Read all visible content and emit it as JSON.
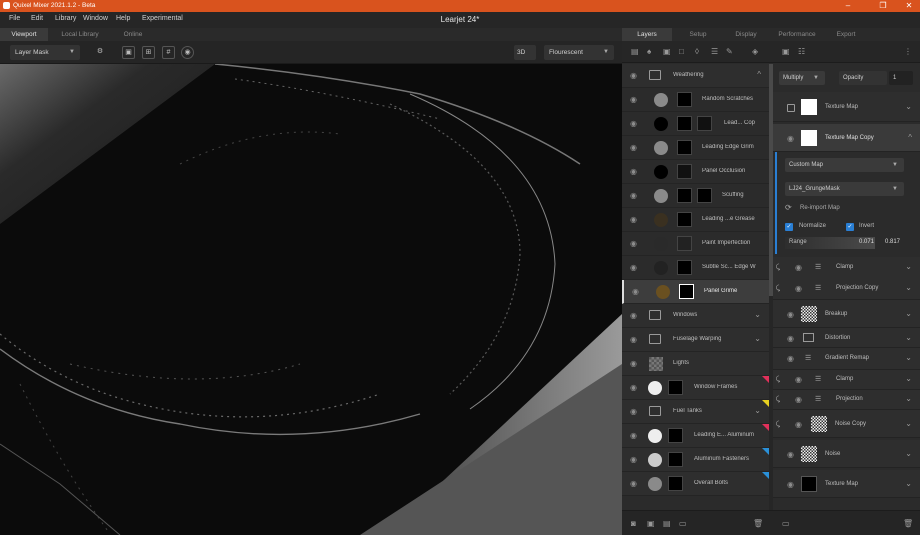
{
  "app": {
    "title": "Quixel Mixer 2021.1.2 - Beta",
    "document": "Learjet 24*"
  },
  "window_controls": {
    "minimize": "–",
    "maximize": "❐",
    "close": "✕"
  },
  "menu": [
    "File",
    "Edit",
    "Library",
    "Window",
    "Help",
    "Experimental"
  ],
  "viewport_tabs": [
    "Viewport",
    "Local Library",
    "Online"
  ],
  "panel_tabs": [
    "Layers",
    "Setup",
    "Display",
    "Performance",
    "Export"
  ],
  "toolbar": {
    "mode": "Layer Mask",
    "view_mode": "3D",
    "lighting": "Flourescent"
  },
  "layers": [
    {
      "name": "Weathering",
      "kind": "folder",
      "expanded": true
    },
    {
      "name": "Random Scratches",
      "kind": "layer",
      "swatch": "#8a8a8a"
    },
    {
      "name": "Lead... Cop",
      "kind": "layer",
      "swatch": "#000000"
    },
    {
      "name": "Leading Edge Grim",
      "kind": "layer",
      "swatch": "#8a8a8a"
    },
    {
      "name": "Panel Occlusion",
      "kind": "layer",
      "swatch": "#000000"
    },
    {
      "name": "Scuffing",
      "kind": "layer",
      "swatch": "#8a8a8a"
    },
    {
      "name": "Leading ...e Grease",
      "kind": "layer",
      "swatch": "#3a3020"
    },
    {
      "name": "Paint Imperfection",
      "kind": "layer",
      "swatch": "#2a2a2a"
    },
    {
      "name": "Subtle Sc... Edge W",
      "kind": "layer",
      "swatch": "#222222"
    },
    {
      "name": "Panel Grime",
      "kind": "layer",
      "swatch": "#6a5020",
      "selected": true
    },
    {
      "name": "Windows",
      "kind": "folder"
    },
    {
      "name": "Fuselage Warping",
      "kind": "folder"
    },
    {
      "name": "Lights",
      "kind": "layer",
      "swatch": "checker"
    },
    {
      "name": "Window Frames",
      "kind": "layer",
      "swatch": "#eeeeee",
      "flag": "#e0305a"
    },
    {
      "name": "Fuel Tanks",
      "kind": "folder",
      "flag": "#e6d020"
    },
    {
      "name": "Leading E... Aluminum",
      "kind": "layer",
      "swatch": "#eeeeee",
      "flag": "#e0305a"
    },
    {
      "name": "Aluminum Fasteners",
      "kind": "layer",
      "swatch": "#cccccc",
      "flag": "#2a90d8"
    },
    {
      "name": "Overall Bolts",
      "kind": "layer",
      "swatch": "#8a8a8a",
      "flag": "#2a90d8"
    }
  ],
  "props": {
    "blend_mode": "Multiply",
    "opacity_label": "Opacity",
    "opacity_value": "1",
    "texture_map": "Texture Map",
    "texture_map_copy": "Texture Map Copy",
    "custom_map": "Custom Map",
    "grunge_mask": "LJ24_GrungeMask",
    "reimport": "Re-import Map",
    "normalize": "Normalize",
    "invert": "Invert",
    "range_label": "Range",
    "range_min": "0.071",
    "range_max": "0.817",
    "stack": [
      "Clamp",
      "Projection Copy",
      "Breakup",
      "Distortion",
      "Gradient Remap",
      "Clamp",
      "Projection",
      "Noise Copy",
      "Noise",
      "Texture Map"
    ]
  }
}
